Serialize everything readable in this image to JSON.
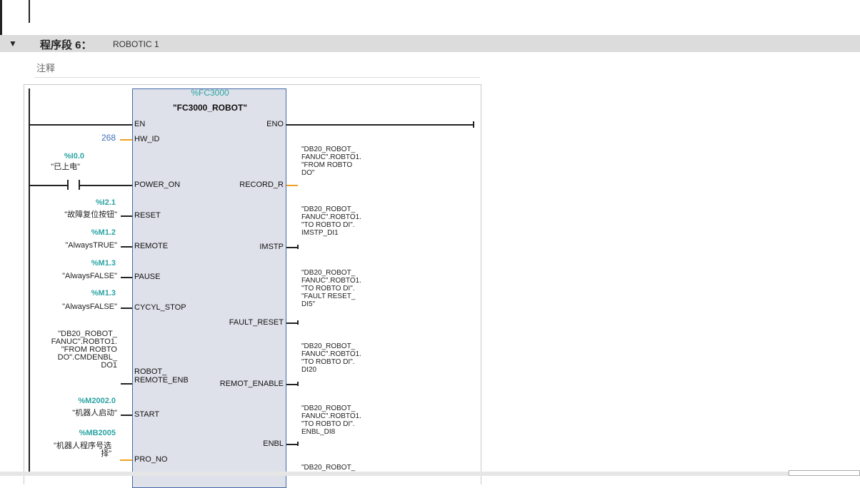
{
  "segment": {
    "toggle": "▼",
    "title": "程序段 6：",
    "name": "ROBOTIC 1",
    "comment": "注释"
  },
  "block": {
    "address": "%FC3000",
    "name": "\"FC3000_ROBOT\"",
    "inputs": [
      "EN",
      "HW_ID",
      "POWER_ON",
      "RESET",
      "REMOTE",
      "PAUSE",
      "CYCYL_STOP",
      "ROBOT_\nREMOTE_ENB",
      "START",
      "PRO_NO"
    ],
    "outputs": [
      "ENO",
      "RECORD_R",
      "IMSTP",
      "FAULT_RESET",
      "REMOT_ENABLE",
      "ENBL"
    ]
  },
  "operands": {
    "hw_id": "268",
    "power_on_addr": "%I0.0",
    "power_on_sym": "\"已上电\"",
    "reset_addr": "%I2.1",
    "reset_sym": "\"故障复位按钮\"",
    "remote_addr": "%M1.2",
    "remote_sym": "\"AlwaysTRUE\"",
    "pause_addr": "%M1.3",
    "pause_sym": "\"AlwaysFALSE\"",
    "cycyl_addr": "%M1.3",
    "cycyl_sym": "\"AlwaysFALSE\"",
    "robot_remote_sym": "\"DB20_ROBOT_\nFANUC\".ROBTO1.\n\"FROM ROBTO\nDO\".CMDENBL_\nDO1",
    "start_addr": "%M2002.0",
    "start_sym": "\"机器人启动\"",
    "pro_no_addr": "%MB2005",
    "pro_no_sym": "\"机器人程序号选\n择\""
  },
  "outputs_text": {
    "record_r": "\"DB20_ROBOT_\nFANUC\".ROBTO1.\n\"FROM ROBTO\nDO\"",
    "imstp": "\"DB20_ROBOT_\nFANUC\".ROBTO1.\n\"TO ROBTO DI\".\nIMSTP_DI1",
    "fault_reset": "\"DB20_ROBOT_\nFANUC\".ROBTO1.\n\"TO ROBTO DI\".\n\"FAULT RESET_\nDI5\"",
    "remot_enable": "\"DB20_ROBOT_\nFANUC\".ROBTO1.\n\"TO ROBTO DI\".\nDI20",
    "enbl": "\"DB20_ROBOT_\nFANUC\".ROBTO1.\n\"TO ROBTO DI\".\nENBL_DI8",
    "next": "\"DB20_ROBOT_"
  },
  "colors": {
    "address": "#2aa3a3",
    "block_fill": "#dfe1ea",
    "block_border": "#4169a8",
    "header_bg": "#dcdcdc",
    "wire_orange": "#f0a020"
  }
}
